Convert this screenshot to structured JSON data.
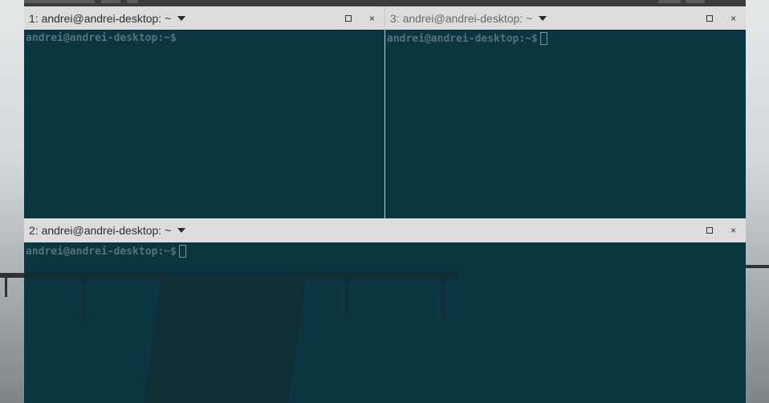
{
  "panes": [
    {
      "title": "1: andrei@andrei-desktop: ~",
      "prompt": "andrei@andrei-desktop:~$",
      "active": true,
      "cursor": false
    },
    {
      "title": "3: andrei@andrei-desktop: ~",
      "prompt": "andrei@andrei-desktop:~$",
      "active": false,
      "cursor": true
    },
    {
      "title": "2: andrei@andrei-desktop: ~",
      "prompt": "andrei@andrei-desktop:~$",
      "active": true,
      "cursor": true
    }
  ],
  "controls": {
    "maximize_icon": "maximize-icon",
    "close_glyph": "×",
    "dropdown_icon": "chevron-down-icon"
  },
  "colors": {
    "terminal_bg": "#0b3541",
    "prompt": "#56737c",
    "header_bg": "#dcdcdc"
  }
}
